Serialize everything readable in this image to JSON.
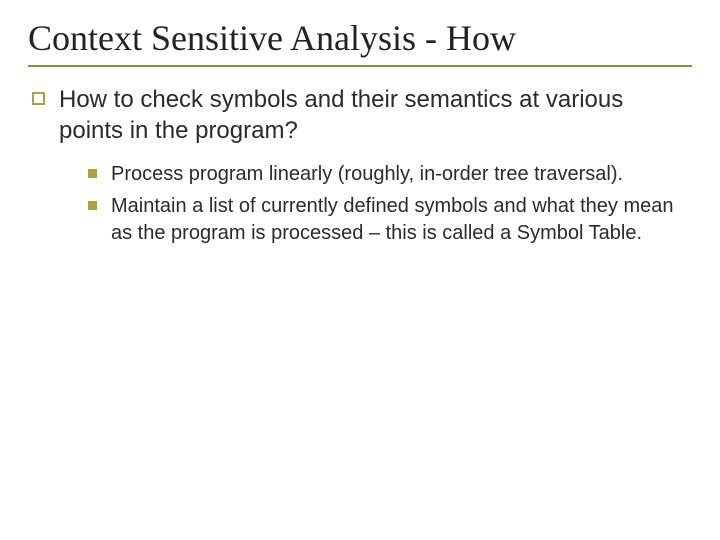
{
  "title": "Context Sensitive Analysis - How",
  "main": {
    "text": "How to check symbols and their semantics at various points in the program?"
  },
  "subs": [
    {
      "text": "Process program linearly (roughly, in-order tree traversal)."
    },
    {
      "text": "Maintain a list of currently defined symbols and what they mean as the program is processed – this is called a Symbol Table."
    }
  ]
}
